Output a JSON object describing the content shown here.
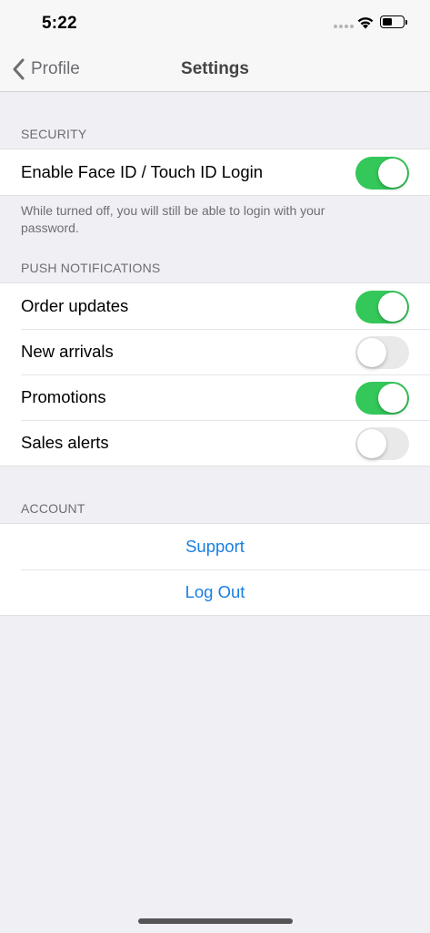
{
  "status_bar": {
    "time": "5:22"
  },
  "nav": {
    "back_label": "Profile",
    "title": "Settings"
  },
  "security": {
    "header": "SECURITY",
    "face_id": {
      "label": "Enable Face ID / Touch ID Login",
      "on": true
    },
    "note": "While turned off, you will still be able to login with your password."
  },
  "push": {
    "header": "PUSH NOTIFICATIONS",
    "items": [
      {
        "label": "Order updates",
        "on": true
      },
      {
        "label": "New arrivals",
        "on": false
      },
      {
        "label": "Promotions",
        "on": true
      },
      {
        "label": "Sales alerts",
        "on": false
      }
    ]
  },
  "account": {
    "header": "ACCOUNT",
    "support_label": "Support",
    "logout_label": "Log Out"
  },
  "colors": {
    "toggle_on": "#34c759",
    "toggle_off": "#e9e9ea",
    "link": "#1a7ee0",
    "background": "#efeff4"
  }
}
